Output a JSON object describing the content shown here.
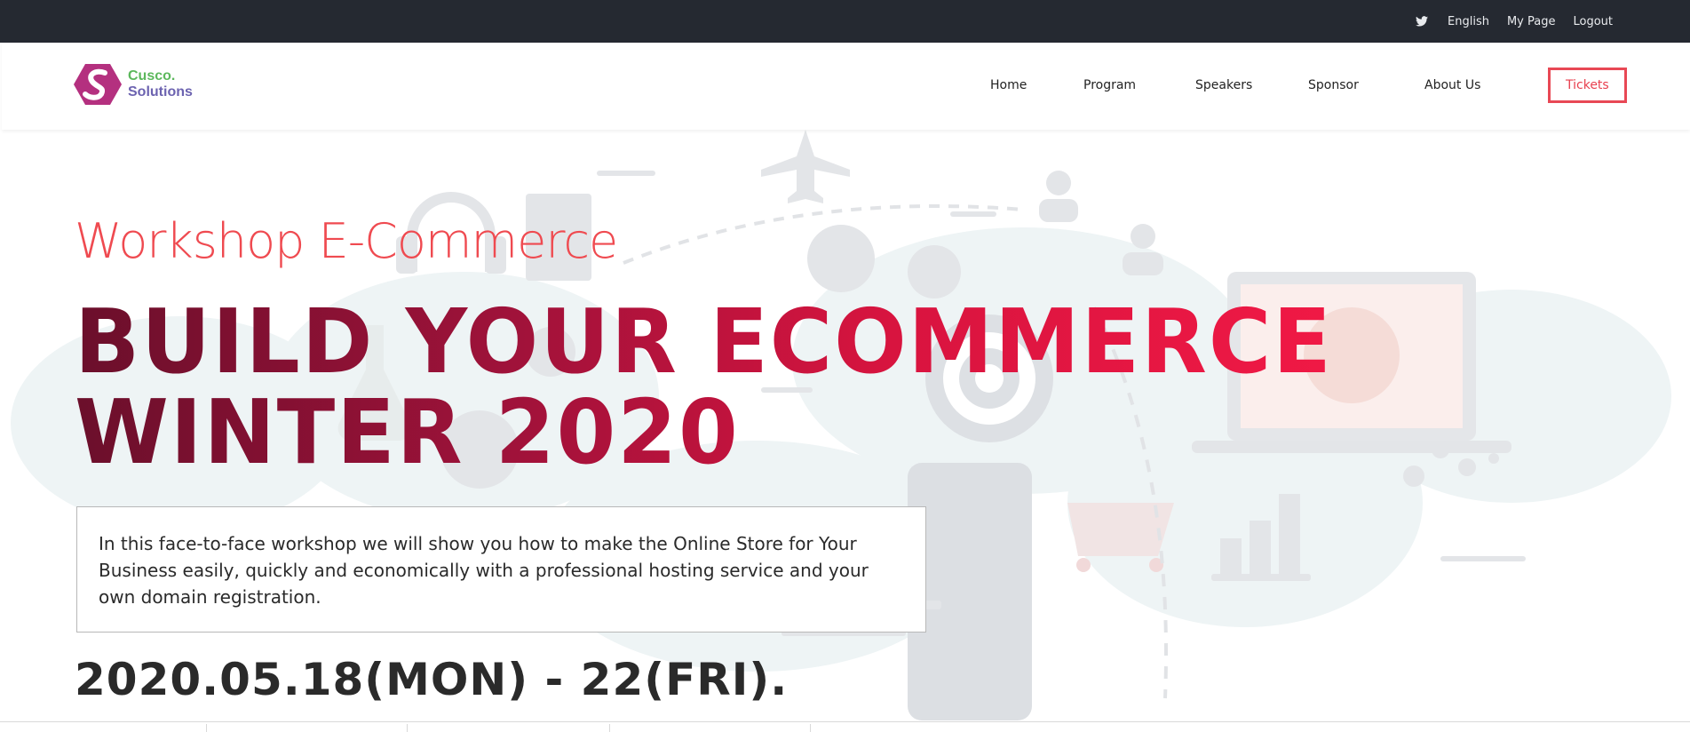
{
  "topbar": {
    "icon": "twitter-icon",
    "links": [
      "English",
      "My Page",
      "Logout"
    ]
  },
  "logo": {
    "line1": "Cusco.",
    "line2": "Solutions"
  },
  "nav": {
    "items": [
      "Home",
      "Program",
      "Speakers",
      "Sponsor",
      "About Us"
    ],
    "tickets": "Tickets"
  },
  "hero": {
    "subtitle": "Workshop E-Commerce",
    "headline_line1": "BUILD YOUR ECOMMERCE",
    "headline_line2": "WINTER 2020",
    "description": "In this face-to-face workshop we will show you how to make the Online Store for Your Business easily, quickly and economically with a professional hosting service and your own domain registration.",
    "date": "2020.05.18(MON) - 22(FRI)."
  },
  "colors": {
    "topbar": "#252931",
    "accent": "#e84855",
    "logo_green": "#5cb85c",
    "logo_purple": "#6c63b0"
  }
}
